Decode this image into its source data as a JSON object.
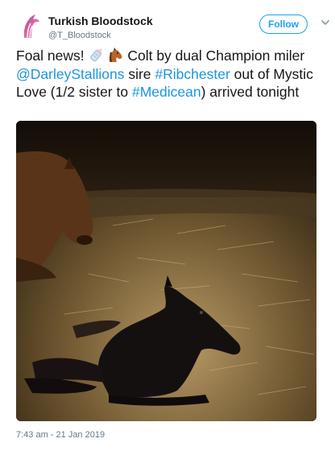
{
  "account": {
    "display_name": "Turkish Bloodstock",
    "handle": "@T_Bloodstock",
    "avatar_icon": "turkish-bloodstock-horse-logo",
    "brand_color": "#7a1a4a"
  },
  "actions": {
    "follow_label": "Follow",
    "menu_icon": "chevron-down-icon"
  },
  "tweet": {
    "text_1": "Foal news! ",
    "emoji_1": "baby-bottle-emoji",
    "emoji_2": "horse-face-emoji",
    "text_2": " Colt by dual Champion miler ",
    "mention": "@DarleyStallions",
    "text_3": " sire ",
    "hashtag_1": "#Ribchester",
    "text_4": " out of Mystic Love (1/2 sister to ",
    "hashtag_2": "#Medicean",
    "text_5": ") arrived tonight",
    "link_color": "#1b95e0"
  },
  "media": {
    "icon": "photo-mare-and-newborn-foal-in-straw"
  },
  "meta": {
    "timestamp": "7:43 am - 21 Jan 2019"
  }
}
